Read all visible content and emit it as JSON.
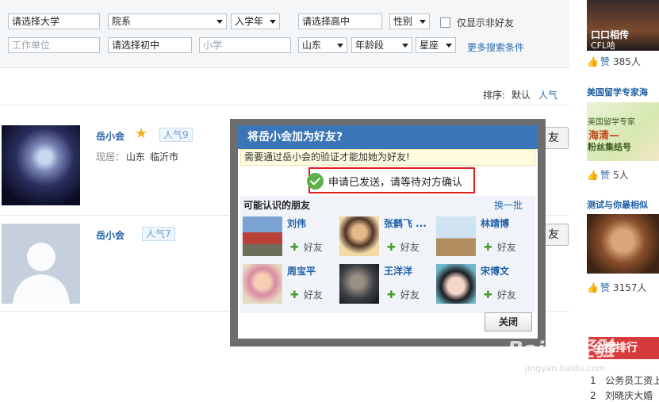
{
  "filters": {
    "university": "请选择大学",
    "department": "院系",
    "enroll_year": "入学年",
    "high_school": "请选择高中",
    "gender": "性别",
    "non_friend_only_label": "仅显示非好友",
    "employer_placeholder": "工作单位",
    "middle_school": "请选择初中",
    "primary_placeholder": "小学",
    "province": "山东",
    "age_group": "年龄段",
    "zodiac": "星座",
    "more_conditions": "更多搜索条件"
  },
  "sort": {
    "label": "排序:",
    "default": "默认",
    "popularity": "人气"
  },
  "results": [
    {
      "name": "岳小会",
      "popularity": "人气9",
      "residence_label": "现居：",
      "residence_province": "山东",
      "residence_city": "临沂市",
      "add_label": "友"
    },
    {
      "name": "岳小会",
      "popularity": "人气7",
      "add_label": "友"
    }
  ],
  "dialog": {
    "title": "将岳小会加为好友?",
    "note": "需要通过岳小会的验证才能加她为好友!",
    "sent_message": "申请已发送，请等待对方确认",
    "suggest_title": "可能认识的朋友",
    "swap_label": "换一批",
    "friends": [
      {
        "name": "刘伟",
        "add": "好友"
      },
      {
        "name": "张鹤飞 ...",
        "add": "好友"
      },
      {
        "name": "林靖博",
        "add": "好友"
      },
      {
        "name": "周宝平",
        "add": "好友"
      },
      {
        "name": "王洋洋",
        "add": "好友"
      },
      {
        "name": "宋博文",
        "add": "好友"
      }
    ],
    "close_label": "关闭"
  },
  "right_column": {
    "item1": {
      "caption": "口口相传",
      "caption2": "CFL哈",
      "likes_label": "赞",
      "likes": "385人"
    },
    "item2": {
      "title": "美国留学专家海",
      "img_line1": "美国留学专家",
      "img_line2": "海清—",
      "img_line3": "粉丝集结号",
      "likes_label": "赞",
      "likes": "5人"
    },
    "item3": {
      "title": "测试与你最相似",
      "likes_label": "赞",
      "likes": "3157人"
    },
    "ranking_title": "全搜排行",
    "ranking_items": [
      {
        "num": "1",
        "text": "公务员工资上"
      },
      {
        "num": "2",
        "text": "刘晓庆大婚"
      }
    ]
  },
  "watermark": {
    "brand": "Baidu经验",
    "url": "jingyan.baidu.com"
  }
}
